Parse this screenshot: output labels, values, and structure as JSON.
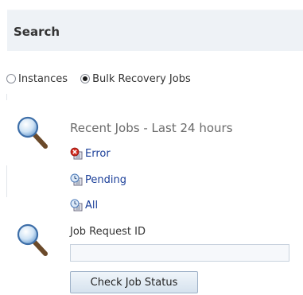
{
  "header": {
    "title": "Search"
  },
  "radio_options": [
    {
      "label": "Instances",
      "selected": false
    },
    {
      "label": "Bulk Recovery Jobs",
      "selected": true
    }
  ],
  "recent_jobs": {
    "title": "Recent Jobs - Last 24 hours",
    "links": [
      {
        "label": "Error",
        "icon": "error-icon"
      },
      {
        "label": "Pending",
        "icon": "pending-clock-icon"
      },
      {
        "label": "All",
        "icon": "all-clock-icon"
      }
    ]
  },
  "job_request": {
    "label": "Job Request ID",
    "value": "",
    "button_label": "Check Job Status"
  },
  "colors": {
    "link": "#1b3f99",
    "header_bg": "#eef2f6",
    "button_border": "#9fb2c8"
  }
}
